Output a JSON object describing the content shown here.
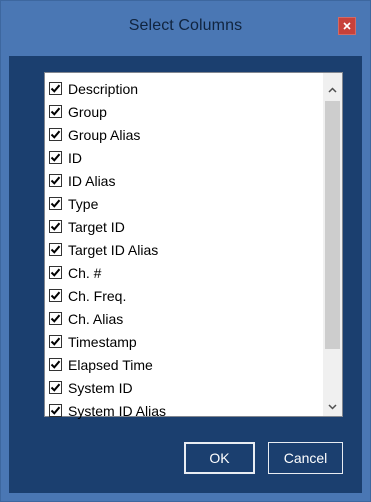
{
  "window": {
    "title": "Select Columns",
    "close_icon": "close-icon",
    "accent_color": "#4a77b4",
    "client_color": "#1b3f6f",
    "close_color": "#c7413a"
  },
  "columns": {
    "items": [
      {
        "label": "Description",
        "checked": true
      },
      {
        "label": "Group",
        "checked": true
      },
      {
        "label": "Group Alias",
        "checked": true
      },
      {
        "label": "ID",
        "checked": true
      },
      {
        "label": "ID Alias",
        "checked": true
      },
      {
        "label": "Type",
        "checked": true
      },
      {
        "label": "Target ID",
        "checked": true
      },
      {
        "label": "Target ID Alias",
        "checked": true
      },
      {
        "label": "Ch. #",
        "checked": true
      },
      {
        "label": "Ch. Freq.",
        "checked": true
      },
      {
        "label": "Ch. Alias",
        "checked": true
      },
      {
        "label": "Timestamp",
        "checked": true
      },
      {
        "label": "Elapsed Time",
        "checked": true
      },
      {
        "label": "System ID",
        "checked": true
      },
      {
        "label": "System ID Alias",
        "checked": true
      }
    ]
  },
  "buttons": {
    "ok_label": "OK",
    "cancel_label": "Cancel"
  }
}
